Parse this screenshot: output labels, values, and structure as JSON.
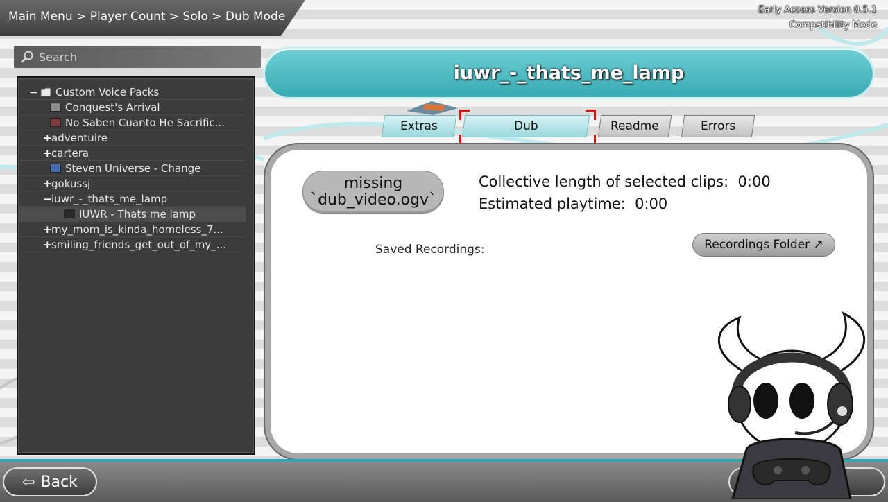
{
  "header": {
    "breadcrumb": "Main Menu > Player Count > Solo > Dub Mode",
    "version_line1": "Early Access Version 0.5.1",
    "version_line2": "Compatibility Mode"
  },
  "search": {
    "placeholder": "Search",
    "value": ""
  },
  "tree": {
    "rows": [
      {
        "toggle": "−",
        "label": "Custom Voice Packs",
        "indent": 0,
        "icon": "folder-icon"
      },
      {
        "toggle": "",
        "label": "Conquest's Arrival",
        "indent": 2,
        "icon": "thumbnail",
        "thumb_color": "#8a8a8a"
      },
      {
        "toggle": "",
        "label": "No Saben Cuanto He Sacrific...",
        "indent": 2,
        "icon": "thumbnail",
        "thumb_color": "#7a3b3b"
      },
      {
        "toggle": "+",
        "label": "adventuire",
        "indent": 1,
        "icon": ""
      },
      {
        "toggle": "+",
        "label": "cartera",
        "indent": 1,
        "icon": ""
      },
      {
        "toggle": "",
        "label": "Steven Universe - Change",
        "indent": 2,
        "icon": "thumbnail",
        "thumb_color": "#4a6fb0"
      },
      {
        "toggle": "+",
        "label": "gokussj",
        "indent": 1,
        "icon": ""
      },
      {
        "toggle": "−",
        "label": "iuwr_-_thats_me_lamp",
        "indent": 1,
        "icon": ""
      },
      {
        "toggle": "",
        "label": "IUWR - Thats me lamp",
        "indent": 3,
        "icon": "thumbnail",
        "thumb_color": "#2a2a2a",
        "selected": true
      },
      {
        "toggle": "+",
        "label": "my_mom_is_kinda_homeless_7...",
        "indent": 1,
        "icon": ""
      },
      {
        "toggle": "+",
        "label": "smiling_friends_get_out_of_my_...",
        "indent": 1,
        "icon": ""
      }
    ]
  },
  "title": "iuwr_-_thats_me_lamp",
  "tabs": {
    "extras": "Extras",
    "dub": "Dub",
    "readme": "Readme",
    "errors": "Errors"
  },
  "main": {
    "missing_line1": "missing",
    "missing_line2": "`dub_video.ogv`",
    "collective_label": "Collective length of selected clips:",
    "collective_value": "0:00",
    "playtime_label": "Estimated playtime:",
    "playtime_value": "0:00",
    "saved_label": "Saved Recordings:",
    "recordings_folder": "Recordings Folder ↗"
  },
  "footer": {
    "back_label": "Back"
  },
  "colors": {
    "accent": "#38aab2",
    "selection": "#e01010"
  }
}
